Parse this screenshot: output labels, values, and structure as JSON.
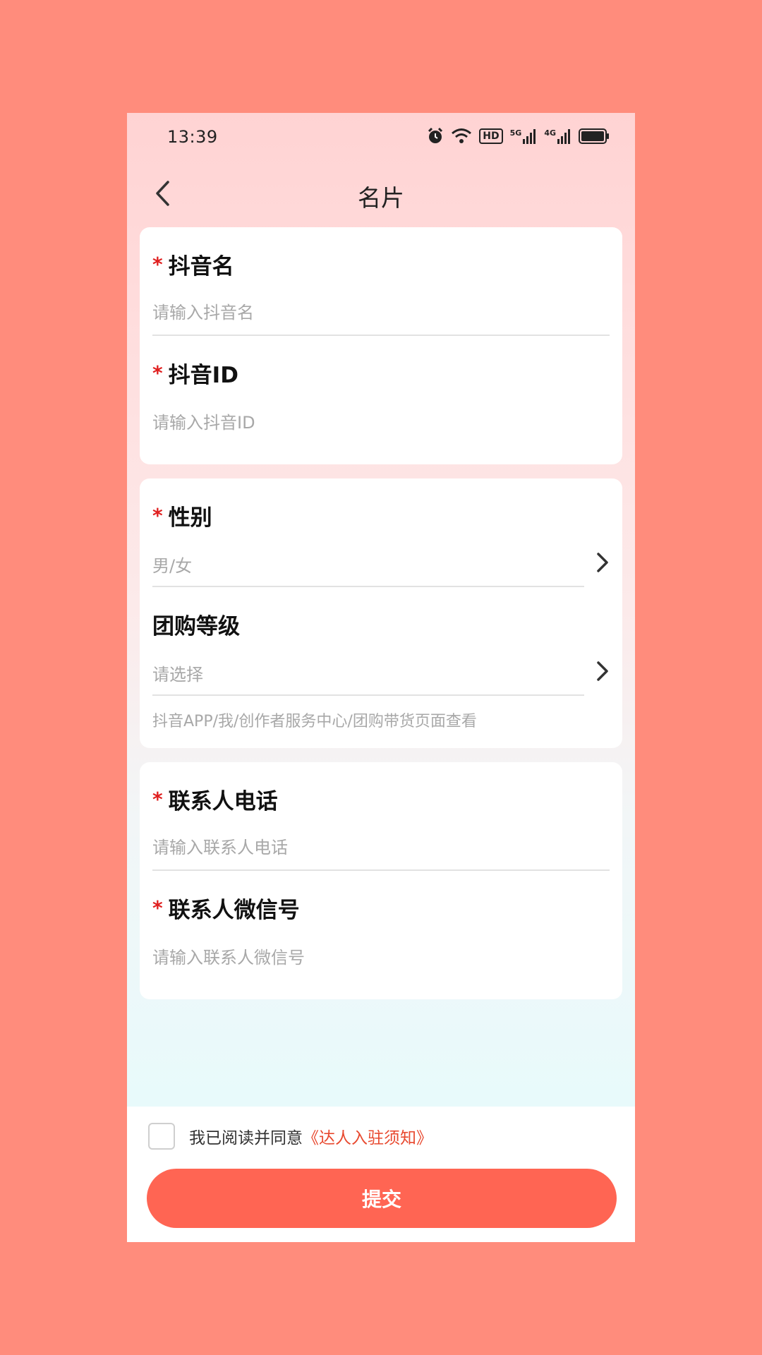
{
  "status_bar": {
    "time": "13:39",
    "icons": [
      "alarm-icon",
      "wifi-icon",
      "hd-icon",
      "signal-5g-icon",
      "signal-4g-icon",
      "battery-icon"
    ],
    "hd_label": "HD",
    "net1_label": "5G",
    "net2_label": "4G"
  },
  "nav": {
    "title": "名片",
    "back_icon": "chevron-left-icon"
  },
  "card1": {
    "douyin_name": {
      "required": "*",
      "label": "抖音名",
      "placeholder": "请输入抖音名",
      "value": ""
    },
    "douyin_id": {
      "required": "*",
      "label": "抖音ID",
      "placeholder": "请输入抖音ID",
      "value": ""
    }
  },
  "card2": {
    "gender": {
      "required": "*",
      "label": "性别",
      "placeholder": "男/女"
    },
    "group_level": {
      "label": "团购等级",
      "placeholder": "请选择"
    },
    "hint": "抖音APP/我/创作者服务中心/团购带货页面查看"
  },
  "card3": {
    "contact_phone": {
      "required": "*",
      "label": "联系人电话",
      "placeholder": "请输入联系人电话",
      "value": ""
    },
    "contact_wechat": {
      "required": "*",
      "label": "联系人微信号",
      "placeholder": "请输入联系人微信号",
      "value": ""
    }
  },
  "footer": {
    "agree_checked": false,
    "agree_text": "我已阅读并同意",
    "agree_link": "《达人入驻须知》",
    "submit_label": "提交"
  },
  "colors": {
    "background": "#FF8C7C",
    "accent": "#FF6553",
    "required": "#E02020",
    "link": "#E8492F"
  }
}
